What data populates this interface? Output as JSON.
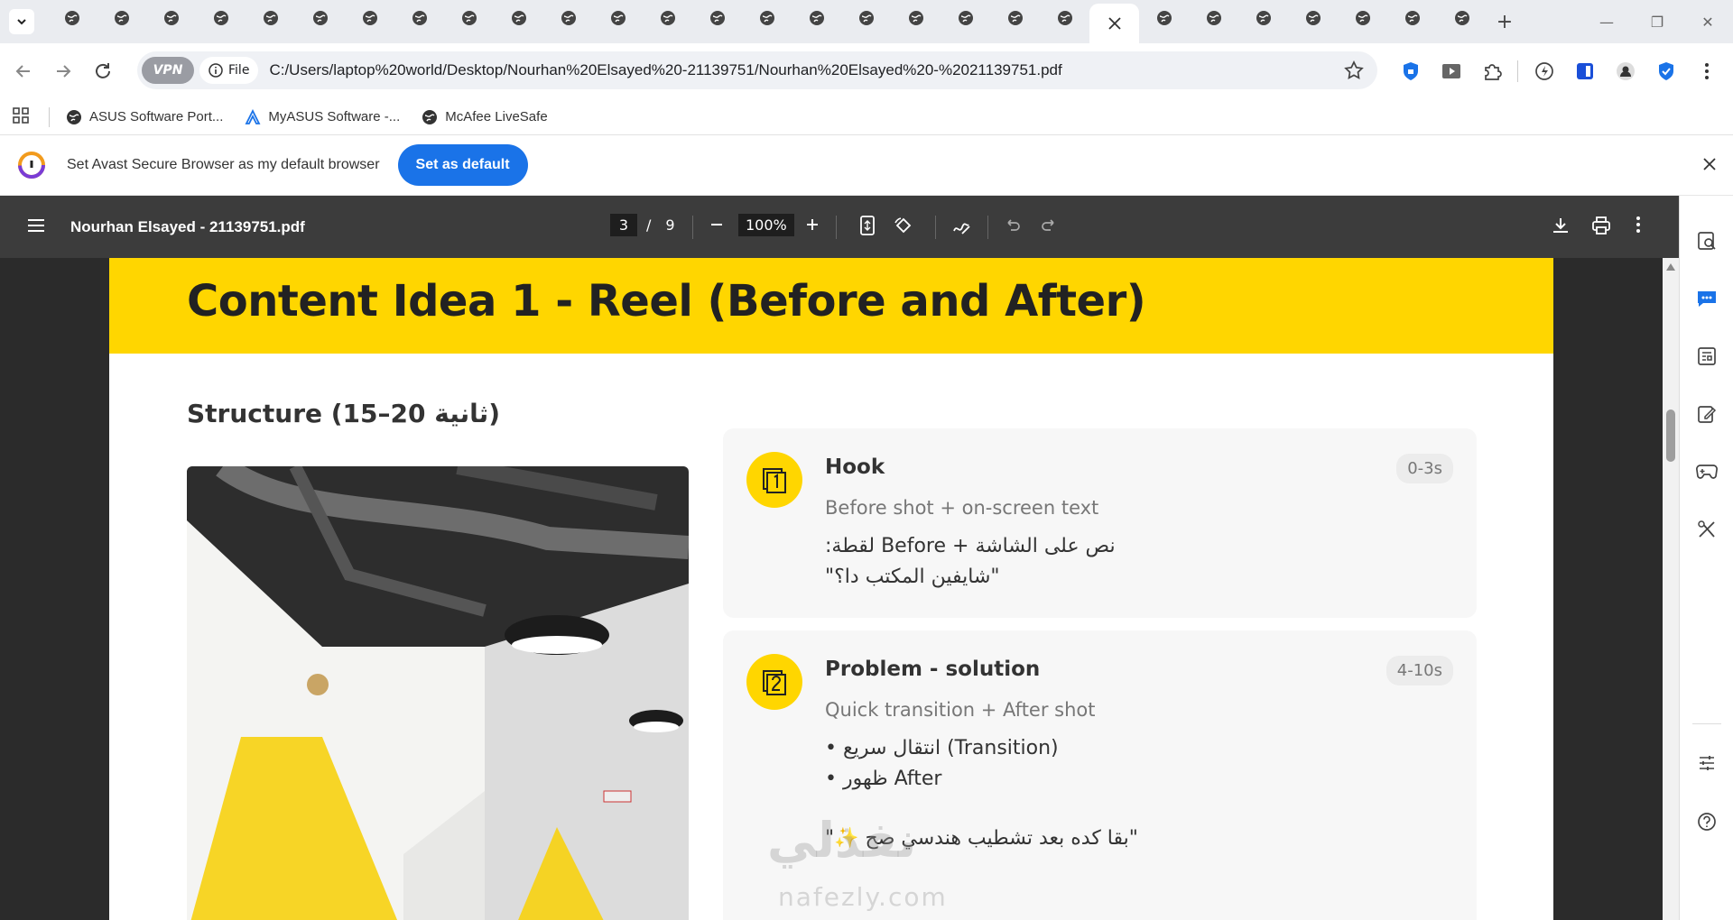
{
  "tabs": {
    "count": 29,
    "active_index": 21
  },
  "address": {
    "vpn_label": "VPN",
    "file_label": "File",
    "url": "C:/Users/laptop%20world/Desktop/Nourhan%20Elsayed%20-21139751/Nourhan%20Elsayed%20-%2021139751.pdf"
  },
  "bookmarks": [
    {
      "label": "ASUS Software Port..."
    },
    {
      "label": "MyASUS Software -..."
    },
    {
      "label": "McAfee LiveSafe"
    }
  ],
  "infobar": {
    "message": "Set Avast Secure Browser as my default browser",
    "button": "Set as default"
  },
  "pdf": {
    "title": "Nourhan Elsayed - 21139751.pdf",
    "page_current": "3",
    "page_sep": "/",
    "page_total": "9",
    "zoom": "100%"
  },
  "content": {
    "banner_title": "Content Idea 1 - Reel (Before and After)",
    "structure": "Structure (15–20 ثانية)",
    "cards": [
      {
        "title": "Hook",
        "time": "0-3s",
        "subtitle": "Before shot + on-screen text",
        "line1": "نص على الشاشة + Before لقطة:",
        "line2": "\"شايفين المكتب دا؟\""
      },
      {
        "title": "Problem - solution",
        "time": "4-10s",
        "subtitle": "Quick transition + After shot",
        "line1": "• انتقال سريع (Transition)",
        "line2": "• ظهور After",
        "line3": "\"بقا كده بعد تشطيب هندسي صح ✨\""
      }
    ]
  },
  "watermark": {
    "arabic": "نفذلي",
    "latin": "nafezly.com"
  }
}
